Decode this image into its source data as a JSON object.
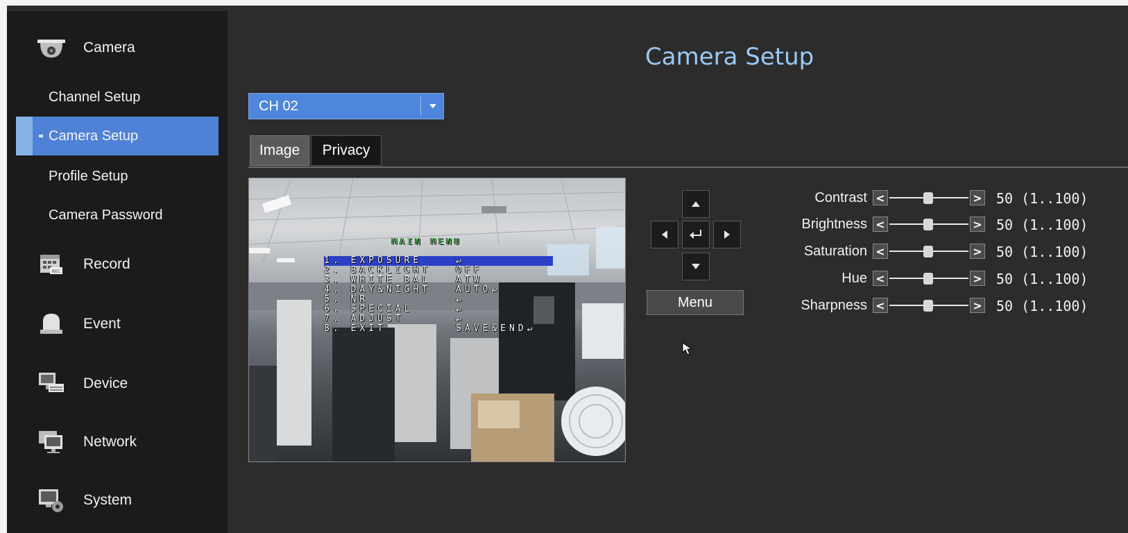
{
  "sidebar": {
    "sections": [
      {
        "label": "Camera",
        "icon": "camera-dome-icon"
      },
      {
        "label": "Record",
        "icon": "record-calendar-icon"
      },
      {
        "label": "Event",
        "icon": "event-alarm-icon"
      },
      {
        "label": "Device",
        "icon": "device-icon"
      },
      {
        "label": "Network",
        "icon": "network-monitor-icon"
      },
      {
        "label": "System",
        "icon": "system-settings-icon"
      }
    ],
    "camera_items": [
      {
        "label": "Channel Setup",
        "active": false
      },
      {
        "label": "Camera Setup",
        "active": true
      },
      {
        "label": "Profile Setup",
        "active": false
      },
      {
        "label": "Camera Password",
        "active": false
      }
    ]
  },
  "header": {
    "title": "Camera Setup"
  },
  "channel_select": {
    "value": "CH 02"
  },
  "tabs": [
    {
      "label": "Image",
      "active": true
    },
    {
      "label": "Privacy",
      "active": false
    }
  ],
  "osd_menu": {
    "title": "MAIN MENU",
    "items": [
      {
        "label": "1. EXPOSURE",
        "value": "↵",
        "selected": true
      },
      {
        "label": "2. BACKLIGHT",
        "value": "OFF",
        "selected": false
      },
      {
        "label": "3. WHITE BAL",
        "value": "ATW",
        "selected": false
      },
      {
        "label": "4. DAY&NIGHT",
        "value": "AUTO↵",
        "selected": false
      },
      {
        "label": "5. NR",
        "value": "↵",
        "selected": false
      },
      {
        "label": "6. SPECIAL",
        "value": "↵",
        "selected": false
      },
      {
        "label": "7. ADJUST",
        "value": "↵",
        "selected": false
      },
      {
        "label": "8. EXIT",
        "value": "SAVE&END↵",
        "selected": false
      }
    ]
  },
  "ptz": {
    "menu_label": "Menu"
  },
  "adjustments": [
    {
      "label": "Contrast",
      "value": 50,
      "range": "(1..100)"
    },
    {
      "label": "Brightness",
      "value": 50,
      "range": "(1..100)"
    },
    {
      "label": "Saturation",
      "value": 50,
      "range": "(1..100)"
    },
    {
      "label": "Hue",
      "value": 50,
      "range": "(1..100)"
    },
    {
      "label": "Sharpness",
      "value": 50,
      "range": "(1..100)"
    }
  ],
  "colors": {
    "active_item": "#4f82d6",
    "title": "#9ac9f4",
    "select_bg": "#4d86dc",
    "osd_selected": "#2b3fc7",
    "osd_title": "#6be06b"
  }
}
